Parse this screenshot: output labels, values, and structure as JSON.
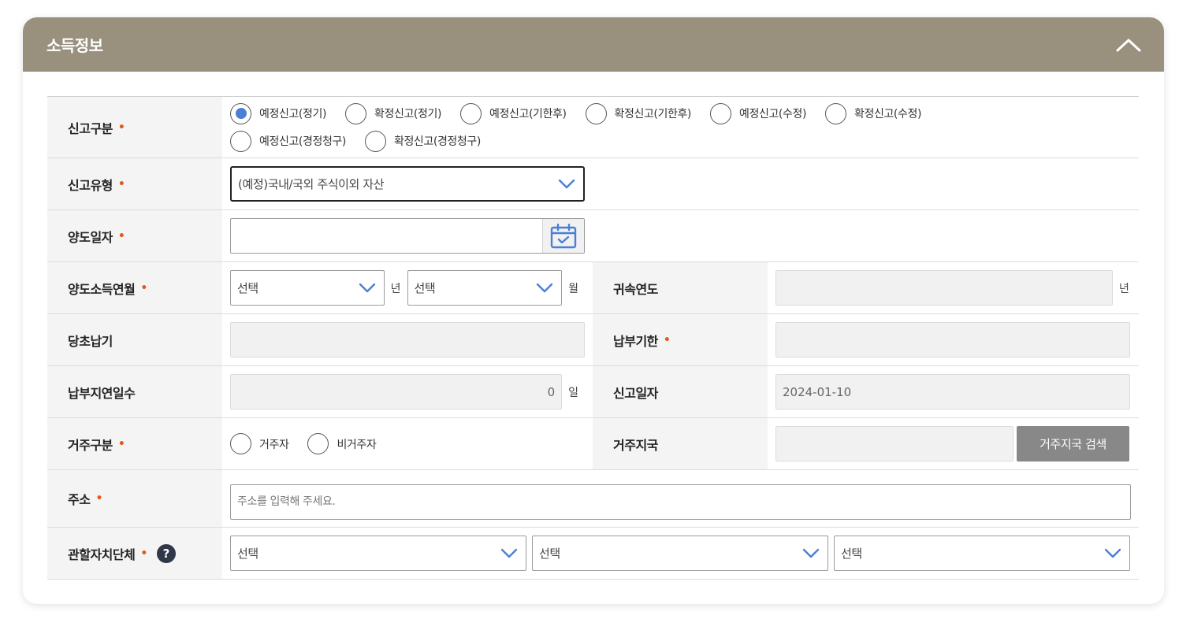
{
  "panel": {
    "title": "소득정보"
  },
  "colors": {
    "header_bg": "#9a907e",
    "required_dot": "#e2591b",
    "radio_checked": "#4a7fd6",
    "chevron": "#4a7fd6"
  },
  "icons": {
    "collapse": "chevron-up-icon",
    "dropdown": "chevron-down-icon",
    "calendar": "calendar-icon",
    "help": "question-icon"
  },
  "required_mark": "•",
  "report_category": {
    "label": "신고구분",
    "options": [
      "예정신고(정기)",
      "확정신고(정기)",
      "예정신고(기한후)",
      "확정신고(기한후)",
      "예정신고(수정)",
      "확정신고(수정)",
      "예정신고(경정청구)",
      "확정신고(경정청구)"
    ],
    "selected": "예정신고(정기)"
  },
  "report_type": {
    "label": "신고유형",
    "value": "(예정)국내/국외 주식이외 자산"
  },
  "transfer_date": {
    "label": "양도일자",
    "value": ""
  },
  "transfer_income_month": {
    "label": "양도소득연월",
    "year_value": "선택",
    "year_unit": "년",
    "month_value": "선택",
    "month_unit": "월"
  },
  "attribution_year": {
    "label": "귀속연도",
    "value": "",
    "unit": "년"
  },
  "original_due": {
    "label": "당초납기",
    "value": ""
  },
  "payment_deadline": {
    "label": "납부기한",
    "value": ""
  },
  "late_days": {
    "label": "납부지연일수",
    "value": "0",
    "unit": "일"
  },
  "report_date": {
    "label": "신고일자",
    "value": "2024-01-10"
  },
  "residency": {
    "label": "거주구분",
    "options": [
      "거주자",
      "비거주자"
    ]
  },
  "residence_office": {
    "label": "거주지국",
    "value": "",
    "search_button": "거주지국 검색"
  },
  "address": {
    "label": "주소",
    "placeholder": "주소를 입력해 주세요."
  },
  "local_government": {
    "label": "관할자치단체",
    "help": "?",
    "selects": [
      "선택",
      "선택",
      "선택"
    ]
  }
}
